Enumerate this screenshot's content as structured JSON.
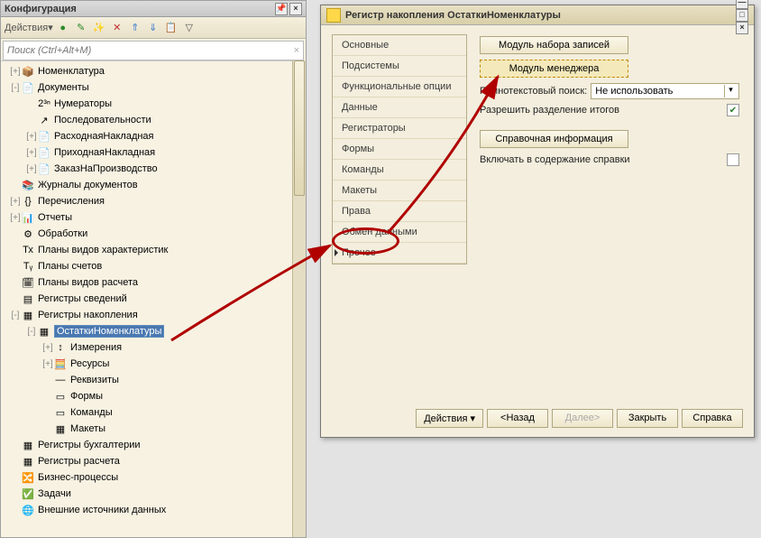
{
  "left": {
    "title": "Конфигурация",
    "actionsLabel": "Действия",
    "searchPlaceholder": "Поиск (Ctrl+Alt+M)",
    "tree": [
      {
        "indent": 0,
        "exp": "+",
        "icon": "📦",
        "label": "Номенклатура"
      },
      {
        "indent": 0,
        "exp": "-",
        "icon": "📄",
        "label": "Документы"
      },
      {
        "indent": 1,
        "exp": "",
        "icon": "2³ⁿ",
        "label": "Нумераторы"
      },
      {
        "indent": 1,
        "exp": "",
        "icon": "↗",
        "label": "Последовательности"
      },
      {
        "indent": 1,
        "exp": "+",
        "icon": "📄",
        "label": "РасходнаяНакладная"
      },
      {
        "indent": 1,
        "exp": "+",
        "icon": "📄",
        "label": "ПриходнаяНакладная"
      },
      {
        "indent": 1,
        "exp": "+",
        "icon": "📄",
        "label": "ЗаказНаПроизводство"
      },
      {
        "indent": 0,
        "exp": "",
        "icon": "📚",
        "label": "Журналы документов"
      },
      {
        "indent": 0,
        "exp": "+",
        "icon": "{}",
        "label": "Перечисления"
      },
      {
        "indent": 0,
        "exp": "+",
        "icon": "📊",
        "label": "Отчеты"
      },
      {
        "indent": 0,
        "exp": "",
        "icon": "⚙",
        "label": "Обработки"
      },
      {
        "indent": 0,
        "exp": "",
        "icon": "Тх",
        "label": "Планы видов характеристик"
      },
      {
        "indent": 0,
        "exp": "",
        "icon": "Тᵧ",
        "label": "Планы счетов"
      },
      {
        "indent": 0,
        "exp": "",
        "icon": "🗓",
        "label": "Планы видов расчета"
      },
      {
        "indent": 0,
        "exp": "",
        "icon": "▤",
        "label": "Регистры сведений"
      },
      {
        "indent": 0,
        "exp": "-",
        "icon": "▦",
        "label": "Регистры накопления"
      },
      {
        "indent": 1,
        "exp": "-",
        "icon": "▦",
        "label": "ОстаткиНоменклатуры",
        "selected": true
      },
      {
        "indent": 2,
        "exp": "+",
        "icon": "↕",
        "label": "Измерения"
      },
      {
        "indent": 2,
        "exp": "+",
        "icon": "🧮",
        "label": "Ресурсы"
      },
      {
        "indent": 2,
        "exp": "",
        "icon": "—",
        "label": "Реквизиты"
      },
      {
        "indent": 2,
        "exp": "",
        "icon": "▭",
        "label": "Формы"
      },
      {
        "indent": 2,
        "exp": "",
        "icon": "▭",
        "label": "Команды"
      },
      {
        "indent": 2,
        "exp": "",
        "icon": "▦",
        "label": "Макеты"
      },
      {
        "indent": 0,
        "exp": "",
        "icon": "▦",
        "label": "Регистры бухгалтерии"
      },
      {
        "indent": 0,
        "exp": "",
        "icon": "▦",
        "label": "Регистры расчета"
      },
      {
        "indent": 0,
        "exp": "",
        "icon": "🔀",
        "label": "Бизнес-процессы"
      },
      {
        "indent": 0,
        "exp": "",
        "icon": "✅",
        "label": "Задачи"
      },
      {
        "indent": 0,
        "exp": "",
        "icon": "🌐",
        "label": "Внешние источники данных"
      }
    ]
  },
  "right": {
    "title": "Регистр накопления ОстаткиНоменклатуры",
    "tabs": [
      "Основные",
      "Подсистемы",
      "Функциональные опции",
      "Данные",
      "Регистраторы",
      "Формы",
      "Команды",
      "Макеты",
      "Права",
      "Обмен данными",
      "Прочее"
    ],
    "activeTab": "Прочее",
    "moduleRecordset": "Модуль набора записей",
    "moduleManager": "Модуль менеджера",
    "fulltextLabel": "Полнотекстовый поиск:",
    "fulltextValue": "Не использовать",
    "allowTotalsLabel": "Разрешить разделение итогов",
    "allowTotalsChecked": true,
    "refInfo": "Справочная информация",
    "includeHelpLabel": "Включать в содержание справки",
    "includeHelpChecked": false,
    "footer": {
      "actions": "Действия",
      "back": "<Назад",
      "next": "Далее>",
      "close": "Закрыть",
      "help": "Справка"
    }
  }
}
